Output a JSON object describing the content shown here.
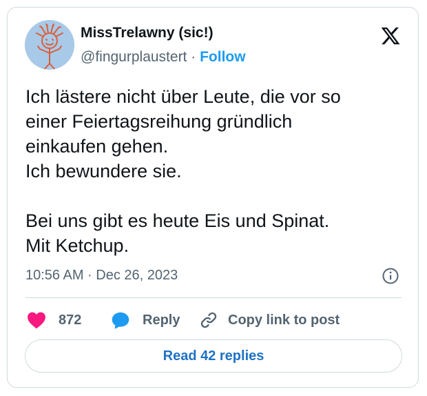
{
  "author": {
    "display_name": "MissTrelawny (sic!)",
    "handle": "@fingurplaustert",
    "separator": "·",
    "follow_label": "Follow"
  },
  "tweet": {
    "text": "Ich lästere nicht über Leute, die vor so\neiner Feiertagsreihung gründlich\neinkaufen gehen.\nIch bewundere sie.\n\nBei uns gibt es heute Eis und Spinat.\nMit Ketchup.",
    "timestamp": "10:56 AM · Dec 26, 2023"
  },
  "actions": {
    "like_count": "872",
    "reply_label": "Reply",
    "copy_link_label": "Copy link to post"
  },
  "read_replies_label": "Read 42 replies",
  "colors": {
    "accent": "#1d9bf0",
    "like": "#f91880",
    "reply": "#1d9bf0",
    "text": "#0f1419",
    "muted": "#536471",
    "border": "#cfd9de"
  },
  "icons": [
    "x-logo-icon",
    "info-icon",
    "heart-icon",
    "reply-bubble-icon",
    "link-icon"
  ]
}
